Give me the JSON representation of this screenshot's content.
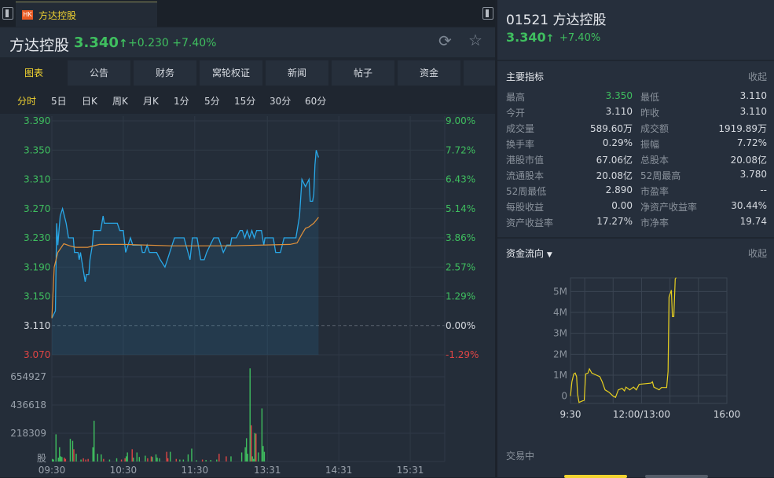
{
  "tab": {
    "badge": "HK",
    "name": "方达控股"
  },
  "header": {
    "name": "方达控股",
    "price": "3.340",
    "arrow": "↑",
    "change": "+0.230",
    "change_pct": "+7.40%"
  },
  "tabs": [
    "图表",
    "公告",
    "财务",
    "窝轮权证",
    "新闻",
    "帖子",
    "资金"
  ],
  "periods": [
    "分时",
    "5日",
    "日K",
    "周K",
    "月K",
    "1分",
    "5分",
    "15分",
    "30分",
    "60分"
  ],
  "chart_data": [
    {
      "type": "line",
      "title": "分时",
      "price_ticks": [
        "3.390",
        "3.350",
        "3.310",
        "3.270",
        "3.230",
        "3.190",
        "3.150",
        "3.110",
        "3.070"
      ],
      "pct_ticks": [
        "9.00%",
        "7.72%",
        "6.43%",
        "5.14%",
        "3.86%",
        "2.57%",
        "1.29%",
        "0.00%",
        "-1.29%"
      ],
      "ylim": [
        3.07,
        3.39
      ],
      "prev_close": 3.11,
      "time_ticks": [
        "09:30",
        "10:30",
        "11:30",
        "13:31",
        "14:31",
        "15:31"
      ],
      "price": [
        [
          0,
          3.12
        ],
        [
          3,
          3.13
        ],
        [
          4,
          3.25
        ],
        [
          5,
          3.22
        ],
        [
          7,
          3.26
        ],
        [
          9,
          3.27
        ],
        [
          12,
          3.25
        ],
        [
          14,
          3.23
        ],
        [
          18,
          3.23
        ],
        [
          19,
          3.21
        ],
        [
          22,
          3.21
        ],
        [
          23,
          3.2
        ],
        [
          24,
          3.21
        ],
        [
          26,
          3.19
        ],
        [
          28,
          3.17
        ],
        [
          29,
          3.18
        ],
        [
          31,
          3.18
        ],
        [
          32,
          3.2
        ],
        [
          34,
          3.22
        ],
        [
          35,
          3.24
        ],
        [
          41,
          3.24
        ],
        [
          43,
          3.26
        ],
        [
          44,
          3.25
        ],
        [
          55,
          3.25
        ],
        [
          57,
          3.24
        ],
        [
          60,
          3.24
        ],
        [
          62,
          3.21
        ],
        [
          64,
          3.22
        ],
        [
          66,
          3.23
        ],
        [
          68,
          3.22
        ],
        [
          75,
          3.22
        ],
        [
          76,
          3.21
        ],
        [
          78,
          3.21
        ],
        [
          80,
          3.22
        ],
        [
          82,
          3.21
        ],
        [
          88,
          3.21
        ],
        [
          91,
          3.2
        ],
        [
          95,
          3.19
        ],
        [
          97,
          3.2
        ],
        [
          101,
          3.22
        ],
        [
          103,
          3.23
        ],
        [
          111,
          3.23
        ],
        [
          116,
          3.2
        ],
        [
          118,
          3.23
        ],
        [
          122,
          3.23
        ],
        [
          125,
          3.2
        ],
        [
          128,
          3.2
        ],
        [
          130,
          3.21
        ],
        [
          133,
          3.22
        ],
        [
          136,
          3.23
        ],
        [
          140,
          3.23
        ],
        [
          142,
          3.22
        ],
        [
          144,
          3.21
        ],
        [
          147,
          3.22
        ],
        [
          150,
          3.22
        ],
        [
          151,
          3.23
        ],
        [
          155,
          3.23
        ],
        [
          158,
          3.24
        ],
        [
          160,
          3.24
        ],
        [
          162,
          3.23
        ],
        [
          164,
          3.24
        ],
        [
          166,
          3.23
        ],
        [
          168,
          3.24
        ],
        [
          170,
          3.23
        ],
        [
          172,
          3.24
        ],
        [
          176,
          3.24
        ],
        [
          178,
          3.22
        ],
        [
          179,
          3.23
        ],
        [
          186,
          3.23
        ],
        [
          188,
          3.21
        ],
        [
          192,
          3.21
        ],
        [
          195,
          3.23
        ],
        [
          205,
          3.23
        ],
        [
          208,
          3.26
        ],
        [
          210,
          3.31
        ],
        [
          213,
          3.3
        ],
        [
          216,
          3.31
        ],
        [
          217,
          3.28
        ],
        [
          219,
          3.28
        ],
        [
          220,
          3.29
        ],
        [
          221,
          3.33
        ],
        [
          222,
          3.35
        ],
        [
          224,
          3.34
        ]
      ],
      "avg": [
        [
          0,
          3.12
        ],
        [
          2,
          3.19
        ],
        [
          5,
          3.21
        ],
        [
          10,
          3.222
        ],
        [
          15,
          3.219
        ],
        [
          20,
          3.217
        ],
        [
          30,
          3.217
        ],
        [
          40,
          3.221
        ],
        [
          60,
          3.221
        ],
        [
          100,
          3.219
        ],
        [
          150,
          3.219
        ],
        [
          200,
          3.221
        ],
        [
          206,
          3.223
        ],
        [
          210,
          3.235
        ],
        [
          213,
          3.243
        ],
        [
          216,
          3.245
        ],
        [
          220,
          3.25
        ],
        [
          224,
          3.258
        ]
      ],
      "volume_ticks": [
        "654927",
        "436618",
        "218309",
        "股"
      ],
      "volume_max": 654927,
      "volume": [
        [
          0,
          20000,
          "up"
        ],
        [
          1,
          15000,
          "up"
        ],
        [
          3,
          210000,
          "up"
        ],
        [
          5,
          30000,
          "up"
        ],
        [
          6,
          110000,
          "up"
        ],
        [
          7,
          40000,
          "up"
        ],
        [
          8,
          35000,
          "up"
        ],
        [
          10,
          30000,
          "down"
        ],
        [
          11,
          20000,
          "down"
        ],
        [
          15,
          175000,
          "up"
        ],
        [
          17,
          160000,
          "up"
        ],
        [
          18,
          95000,
          "down"
        ],
        [
          20,
          60000,
          "up"
        ],
        [
          24,
          15000,
          "up"
        ],
        [
          26,
          25000,
          "down"
        ],
        [
          28,
          15000,
          "down"
        ],
        [
          30,
          20000,
          "down"
        ],
        [
          34,
          110000,
          "up"
        ],
        [
          35,
          315000,
          "up"
        ],
        [
          38,
          60000,
          "up"
        ],
        [
          41,
          55000,
          "up"
        ],
        [
          43,
          20000,
          "down"
        ],
        [
          48,
          15000,
          "up"
        ],
        [
          54,
          25000,
          "up"
        ],
        [
          58,
          15000,
          "down"
        ],
        [
          61,
          25000,
          "down"
        ],
        [
          62,
          40000,
          "up"
        ],
        [
          63,
          70000,
          "up"
        ],
        [
          67,
          95000,
          "down"
        ],
        [
          68,
          30000,
          "up"
        ],
        [
          71,
          70000,
          "up"
        ],
        [
          73,
          35000,
          "up"
        ],
        [
          78,
          45000,
          "up"
        ],
        [
          80,
          25000,
          "down"
        ],
        [
          83,
          40000,
          "down"
        ],
        [
          84,
          35000,
          "up"
        ],
        [
          87,
          55000,
          "up"
        ],
        [
          88,
          30000,
          "up"
        ],
        [
          90,
          25000,
          "up"
        ],
        [
          96,
          75000,
          "down"
        ],
        [
          97,
          25000,
          "down"
        ],
        [
          99,
          75000,
          "up"
        ],
        [
          104,
          20000,
          "down"
        ],
        [
          107,
          15000,
          "up"
        ],
        [
          110,
          15000,
          "up"
        ],
        [
          114,
          55000,
          "up"
        ],
        [
          117,
          100000,
          "up"
        ],
        [
          121,
          10000,
          "up"
        ],
        [
          126,
          15000,
          "down"
        ],
        [
          129,
          12000,
          "up"
        ],
        [
          133,
          12000,
          "up"
        ],
        [
          138,
          15000,
          "up"
        ],
        [
          140,
          60000,
          "down"
        ],
        [
          146,
          40000,
          "down"
        ],
        [
          150,
          40000,
          "up"
        ],
        [
          159,
          70000,
          "up"
        ],
        [
          162,
          110000,
          "up"
        ],
        [
          163,
          180000,
          "up"
        ],
        [
          164,
          60000,
          "up"
        ],
        [
          166,
          720000,
          "up"
        ],
        [
          167,
          280000,
          "down"
        ],
        [
          168,
          40000,
          "up"
        ],
        [
          169,
          20000,
          "up"
        ],
        [
          170,
          220000,
          "up"
        ],
        [
          171,
          215000,
          "down"
        ],
        [
          173,
          70000,
          "up"
        ],
        [
          176,
          410000,
          "up"
        ],
        [
          177,
          120000,
          "up"
        ],
        [
          178,
          75000,
          "up"
        ]
      ]
    },
    {
      "type": "line",
      "title": "资金流向",
      "y_ticks": [
        "5M",
        "4M",
        "3M",
        "2M",
        "1M",
        "0"
      ],
      "x_ticks": [
        "9:30",
        "12:00/13:00",
        "16:00"
      ],
      "ylim": [
        -0.35,
        5.65
      ],
      "series": [
        [
          0,
          0
        ],
        [
          3,
          0.68
        ],
        [
          7,
          1.06
        ],
        [
          10,
          1.1
        ],
        [
          13,
          0.93
        ],
        [
          15,
          0.1
        ],
        [
          18,
          -0.3
        ],
        [
          23,
          -0.25
        ],
        [
          29,
          -0.2
        ],
        [
          32,
          1.06
        ],
        [
          37,
          1.1
        ],
        [
          40,
          1.3
        ],
        [
          45,
          1.1
        ],
        [
          62,
          0.93
        ],
        [
          67,
          0.68
        ],
        [
          73,
          0.3
        ],
        [
          81,
          0.19
        ],
        [
          90,
          0
        ],
        [
          95,
          -0.06
        ],
        [
          101,
          0.3
        ],
        [
          109,
          0.37
        ],
        [
          114,
          0.25
        ],
        [
          117,
          0.43
        ],
        [
          125,
          0.3
        ],
        [
          133,
          0.43
        ],
        [
          139,
          0.3
        ],
        [
          145,
          0.56
        ],
        [
          170,
          0.62
        ],
        [
          173,
          0.68
        ],
        [
          176,
          0.43
        ],
        [
          187,
          0.3
        ],
        [
          192,
          0.41
        ],
        [
          203,
          0.41
        ],
        [
          206,
          1.18
        ],
        [
          208,
          4.73
        ],
        [
          213,
          5.06
        ],
        [
          215,
          3.8
        ],
        [
          218,
          3.8
        ],
        [
          221,
          5.6
        ],
        [
          223,
          5.66
        ]
      ]
    }
  ],
  "right": {
    "title": "01521 方达控股",
    "price": "3.340",
    "arrow": "↑",
    "change_pct": "+7.40%",
    "indicators_title": "主要指标",
    "collapse": "收起",
    "indicators": [
      [
        "最高",
        "3.350",
        "最低",
        "3.110"
      ],
      [
        "今开",
        "3.110",
        "昨收",
        "3.110"
      ],
      [
        "成交量",
        "589.60万",
        "成交额",
        "1919.89万"
      ],
      [
        "换手率",
        "0.29%",
        "振幅",
        "7.72%"
      ],
      [
        "港股市值",
        "67.06亿",
        "总股本",
        "20.08亿"
      ],
      [
        "流通股本",
        "20.08亿",
        "52周最高",
        "3.780"
      ],
      [
        "52周最低",
        "2.890",
        "市盈率",
        "--"
      ],
      [
        "每股收益",
        "0.00",
        "净资产收益率",
        "30.44%"
      ],
      [
        "资产收益率",
        "17.27%",
        "市净率",
        "19.74"
      ]
    ],
    "flow_title": "资金流向",
    "flow_collapse": "收起",
    "status": "交易中"
  },
  "colors": {
    "up": "#3fbf5f",
    "down": "#e04545",
    "accent": "#f2d431",
    "price_line": "#29a8e8",
    "avg_line": "#e0903a"
  }
}
